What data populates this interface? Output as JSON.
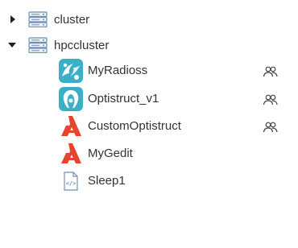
{
  "tree": {
    "clusters": [
      {
        "name": "cluster",
        "expanded": false,
        "icon": "server-icon"
      },
      {
        "name": "hpccluster",
        "expanded": true,
        "icon": "server-icon",
        "apps": [
          {
            "name": "MyRadioss",
            "icon": "radioss-icon",
            "shared": true
          },
          {
            "name": "Optistruct_v1",
            "icon": "optistruct-icon",
            "shared": true
          },
          {
            "name": "CustomOptistruct",
            "icon": "altair-logo-icon",
            "shared": true
          },
          {
            "name": "MyGedit",
            "icon": "altair-logo-icon",
            "shared": false
          },
          {
            "name": "Sleep1",
            "icon": "script-file-icon",
            "shared": false
          }
        ]
      }
    ]
  },
  "colors": {
    "altair_red": "#e8442b",
    "teal": "#3ab0c8",
    "server_blue": "#6e8fb5",
    "arrow": "#222222"
  }
}
